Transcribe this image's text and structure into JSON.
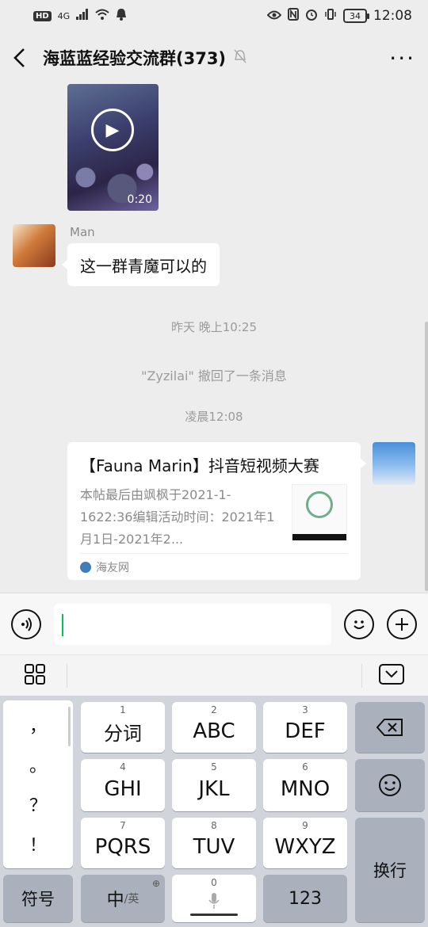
{
  "status_bar": {
    "network": "4G",
    "time": "12:08",
    "battery": "34"
  },
  "header": {
    "title": "海蓝蓝经验交流群(373)",
    "more": "···"
  },
  "messages": {
    "video_duration": "0:20",
    "text_msg": {
      "sender": "Man",
      "text": "这一群青魔可以的"
    },
    "time_1": "昨天 晚上10:25",
    "recall_notice": "\"Zyzilai\" 撤回了一条消息",
    "time_2": "凌晨12:08",
    "link_card": {
      "title": "【Fauna Marin】抖音短视频大赛",
      "description": "本帖最后由飒枫于2021-1-1622:36编辑活动时间：2021年1月1日-2021年2...",
      "source": "海友网"
    }
  },
  "keyboard": {
    "punctuation": [
      "，",
      "。",
      "？",
      "！"
    ],
    "keys": [
      {
        "num": "1",
        "label": "分词"
      },
      {
        "num": "2",
        "label": "ABC"
      },
      {
        "num": "3",
        "label": "DEF"
      },
      {
        "num": "4",
        "label": "GHI"
      },
      {
        "num": "5",
        "label": "JKL"
      },
      {
        "num": "6",
        "label": "MNO"
      },
      {
        "num": "7",
        "label": "PQRS"
      },
      {
        "num": "8",
        "label": "TUV"
      },
      {
        "num": "9",
        "label": "WXYZ"
      }
    ],
    "symbols": "符号",
    "lang_main": "中",
    "lang_alt": "/英",
    "space_num": "0",
    "num_key": "123",
    "enter": "换行"
  }
}
